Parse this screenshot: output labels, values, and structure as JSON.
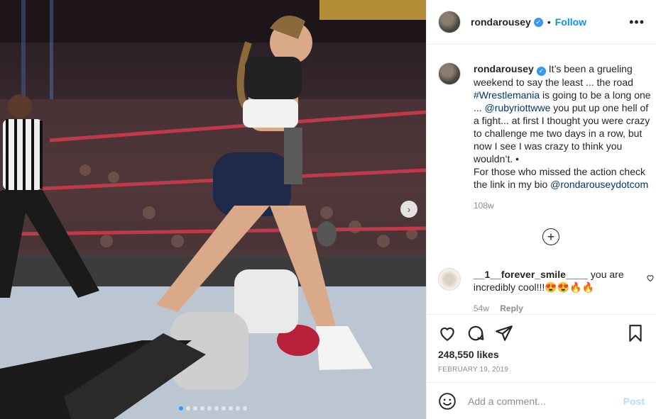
{
  "post": {
    "username": "rondarousey",
    "follow_label": "Follow",
    "more_label": "•••",
    "caption": {
      "username": "rondarousey",
      "text_1": "It’s been a grueling weekend to say the least ... the road ",
      "hashtag": "#Wrestlemania",
      "text_2": " is going to be a long one ... ",
      "mention_1": "@rubyriottwwe",
      "text_3": " you put up one hell of a fight... at first I thought you were crazy to challenge me two days in a row, but now I see I was crazy to think you wouldn’t. •",
      "text_4": "For those who missed the action check the link in my bio ",
      "mention_2": "@rondarouseydotcom",
      "age": "108w"
    },
    "comments": [
      {
        "username": "__1__forever_smile____",
        "text": " you are incredibly cool!!!😍😍🔥🔥",
        "age": "54w",
        "reply_label": "Reply"
      }
    ],
    "likes": "248,550 likes",
    "date": "FEBRUARY 19, 2019",
    "add_comment_placeholder": "Add a comment...",
    "post_button": "Post",
    "carousel": {
      "count": 10,
      "active_index": 0
    },
    "colors": {
      "accent": "#0095f6",
      "verified": "#3897f0",
      "post_disabled": "#b2dffc"
    },
    "icons": [
      "verified-icon",
      "more-icon",
      "heart-icon",
      "comment-icon",
      "share-icon",
      "save-icon",
      "emoji-icon",
      "plus-circle-icon",
      "chevron-right-icon"
    ]
  }
}
